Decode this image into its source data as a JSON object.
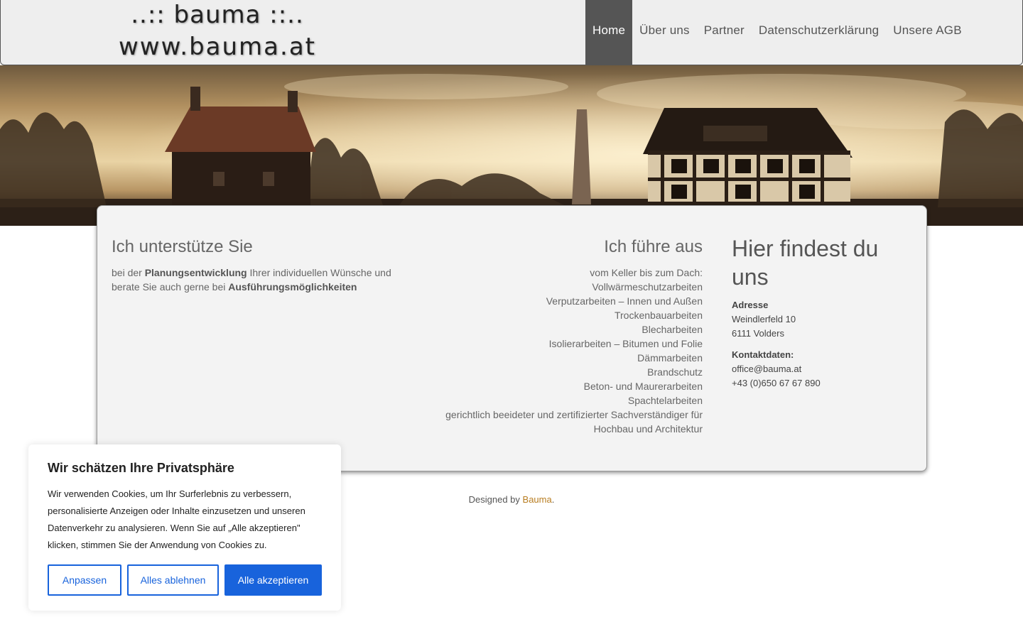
{
  "header": {
    "logo_line1": "..:: bauma ::..",
    "logo_line2": "www.bauma.at",
    "nav": [
      {
        "label": "Home",
        "active": true
      },
      {
        "label": "Über uns",
        "active": false
      },
      {
        "label": "Partner",
        "active": false
      },
      {
        "label": "Datenschutzerklärung",
        "active": false
      },
      {
        "label": "Unsere AGB",
        "active": false
      }
    ]
  },
  "content": {
    "col1": {
      "heading": "Ich unterstütze Sie",
      "text_1": "bei der ",
      "bold_1": "Planungsentwicklung",
      "text_2": " Ihrer individuellen Wünsche und berate Sie auch gerne bei ",
      "bold_2": "Ausführungsmöglichkeiten"
    },
    "col2": {
      "heading": "Ich führe aus",
      "items": [
        "vom Keller bis zum Dach:",
        "Vollwärmeschutzarbeiten",
        "Verputzarbeiten – Innen und Außen",
        "Trockenbauarbeiten",
        "Blecharbeiten",
        "Isolierarbeiten – Bitumen und Folie",
        "Dämmarbeiten",
        "Brandschutz",
        "Beton- und Maurerarbeiten",
        "Spachtelarbeiten",
        "gerichtlich beeideter und zertifizierter Sachverständiger für Hochbau und Architektur"
      ]
    },
    "col3": {
      "heading": "Hier findest du uns",
      "address_label": "Adresse",
      "street": "Weindlerfeld 10",
      "city": "6111 Volders",
      "contact_label": "Kontaktdaten:",
      "email": "office@bauma.at",
      "phone": "+43 (0)650 67 67 890"
    }
  },
  "footer": {
    "prefix": "Designed by ",
    "link": "Bauma",
    "suffix": "."
  },
  "cookie": {
    "title": "Wir schätzen Ihre Privatsphäre",
    "text": "Wir verwenden Cookies, um Ihr Surferlebnis zu verbessern, personalisierte Anzeigen oder Inhalte einzusetzen und unseren Datenverkehr zu analysieren. Wenn Sie auf „Alle akzeptieren\" klicken, stimmen Sie der Anwendung von Cookies zu.",
    "btn_customize": "Anpassen",
    "btn_reject": "Alles ablehnen",
    "btn_accept": "Alle akzeptieren"
  },
  "colors": {
    "accent": "#1863dc",
    "nav_active": "#555555",
    "footer_link": "#b87d21"
  }
}
